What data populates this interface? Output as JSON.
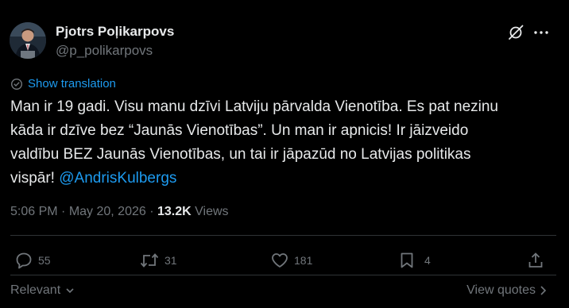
{
  "author": {
    "name": "Pjotrs Poļikarpovs",
    "handle": "@p_polikarpovs"
  },
  "translate_label": "Show translation",
  "text": {
    "line1": "Man ir 19 gadi. Visu manu dzīvi Latviju pārvalda Vienotība. Es pat nezinu",
    "line2": "kāda ir dzīve bez “Jaunās Vienotības”. Un man ir apnicis! Ir jāizveido",
    "line3": "valdību BEZ Jaunās Vienotības, un tai ir jāpazūd no Latvijas politikas",
    "line4_prefix": "vispār! ",
    "mention": "@AndrisKulbergs"
  },
  "meta": {
    "time": "5:06 PM",
    "separator": " · ",
    "date": "May 20, 2026",
    "views_count": "13.2K",
    "views_label": " Views"
  },
  "actions": {
    "replies": "55",
    "reposts": "31",
    "likes": "181",
    "bookmarks": "4"
  },
  "footer": {
    "sort_label": "Relevant",
    "quotes_label": "View quotes"
  },
  "colors": {
    "background": "#000000",
    "text": "#e7e9ea",
    "secondary": "#71767b",
    "accent": "#1d9bf0",
    "divider": "#2f3336"
  }
}
